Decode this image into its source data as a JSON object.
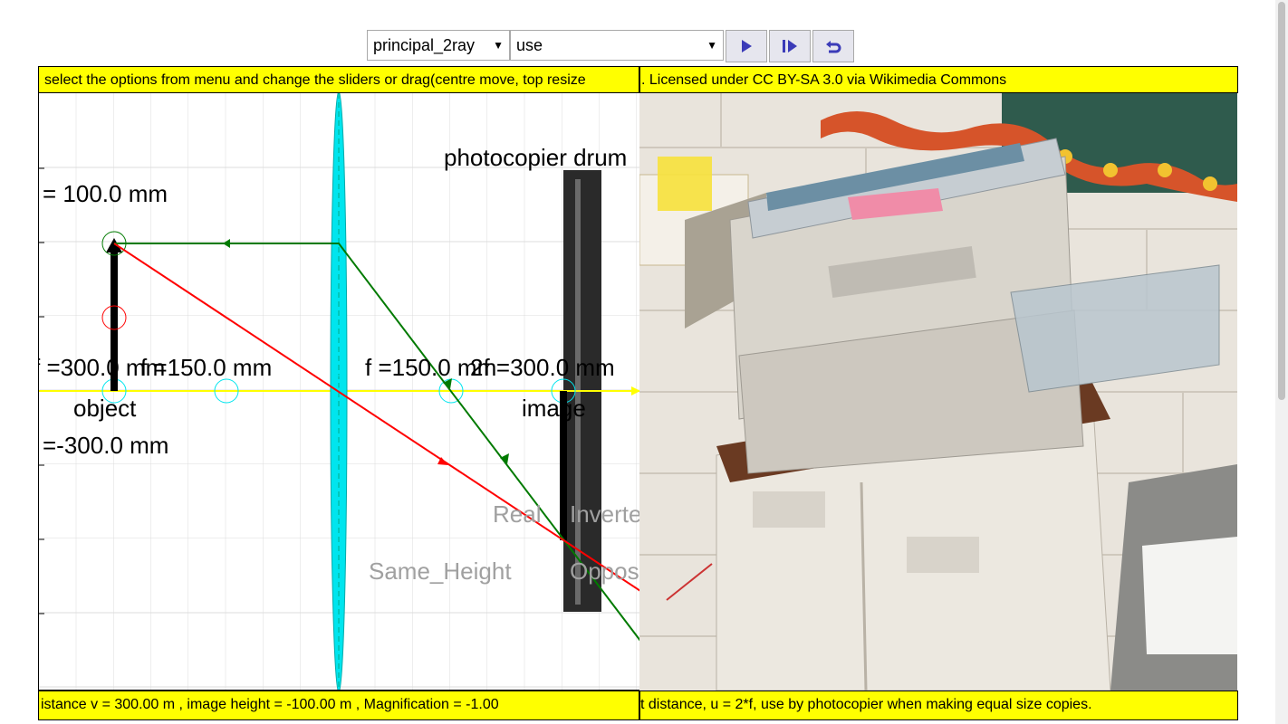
{
  "toolbar": {
    "mode_select": "principal_2ray",
    "use_select": "use",
    "play_label": "play",
    "step_label": "step",
    "reset_label": "reset"
  },
  "top_bar": {
    "left_text": "select the options from menu and change the sliders or drag(centre move, top resize",
    "right_text": ". Licensed under CC BY-SA 3.0 via Wikimedia Commons"
  },
  "bottom_bar": {
    "left_text": "istance v = 300.00 m , image height = -100.00 m , Magnification = -1.00",
    "right_text": "t distance, u = 2*f, use by photocopier when making equal size copies."
  },
  "sim": {
    "object_height": "= 100.0 mm",
    "label_2f_left": "f =300.0 mm",
    "label_f_left": "f =150.0 mm",
    "label_f_right": "f =150.0 mm",
    "label_2f_right": "2f =300.0 mm",
    "object_label": "object",
    "object_distance": "=-300.0 mm",
    "image_label": "image",
    "drum_label": "photocopier drum",
    "real_label": "Real",
    "inverted_label": "Inverted",
    "same_height_label": "Same_Height",
    "opposite_label": "Opposite"
  },
  "colors": {
    "lens": "#00e5ee",
    "ray_green": "#007a00",
    "ray_red": "#ff0000",
    "axis": "#ffff00",
    "bar": "#ffff00"
  }
}
